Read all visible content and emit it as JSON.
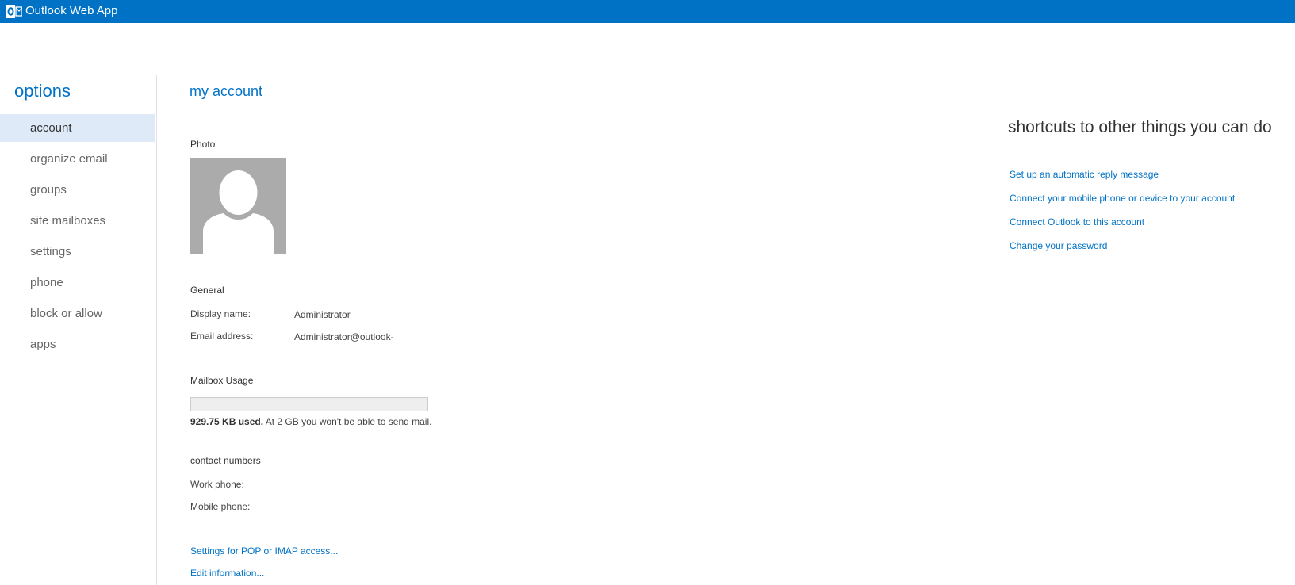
{
  "topbar": {
    "app_title": "Outlook Web App",
    "logo_icon": "outlook-logo-icon",
    "background": "#0072c6"
  },
  "sidebar": {
    "title": "options",
    "items": [
      {
        "label": "account",
        "selected": true
      },
      {
        "label": "organize email",
        "selected": false
      },
      {
        "label": "groups",
        "selected": false
      },
      {
        "label": "site mailboxes",
        "selected": false
      },
      {
        "label": "settings",
        "selected": false
      },
      {
        "label": "phone",
        "selected": false
      },
      {
        "label": "block or allow",
        "selected": false
      },
      {
        "label": "apps",
        "selected": false
      }
    ]
  },
  "main": {
    "title": "my account",
    "photo_label": "Photo",
    "photo_icon": "default-user-avatar-icon",
    "general": {
      "heading": "General",
      "display_name_label": "Display name:",
      "display_name_value": "Administrator",
      "email_label": "Email address:",
      "email_value": "Administrator@outlook-"
    },
    "mailbox": {
      "heading": "Mailbox Usage",
      "used_fraction": 0.0,
      "used_text": "929.75 KB used.",
      "limit_text": " At 2 GB you won't be able to send mail."
    },
    "contact": {
      "heading": "contact numbers",
      "work_phone_label": "Work phone:",
      "mobile_phone_label": "Mobile phone:"
    },
    "links": {
      "pop_imap": "Settings for POP or IMAP access...",
      "edit_info": "Edit information..."
    }
  },
  "shortcuts": {
    "title": "shortcuts to other things you can do",
    "links": [
      "Set up an automatic reply message",
      "Connect your mobile phone or device to your account",
      "Connect Outlook to this account",
      "Change your password"
    ]
  },
  "colors": {
    "accent": "#0072c6",
    "selected_nav_bg": "#dfeaf8"
  }
}
